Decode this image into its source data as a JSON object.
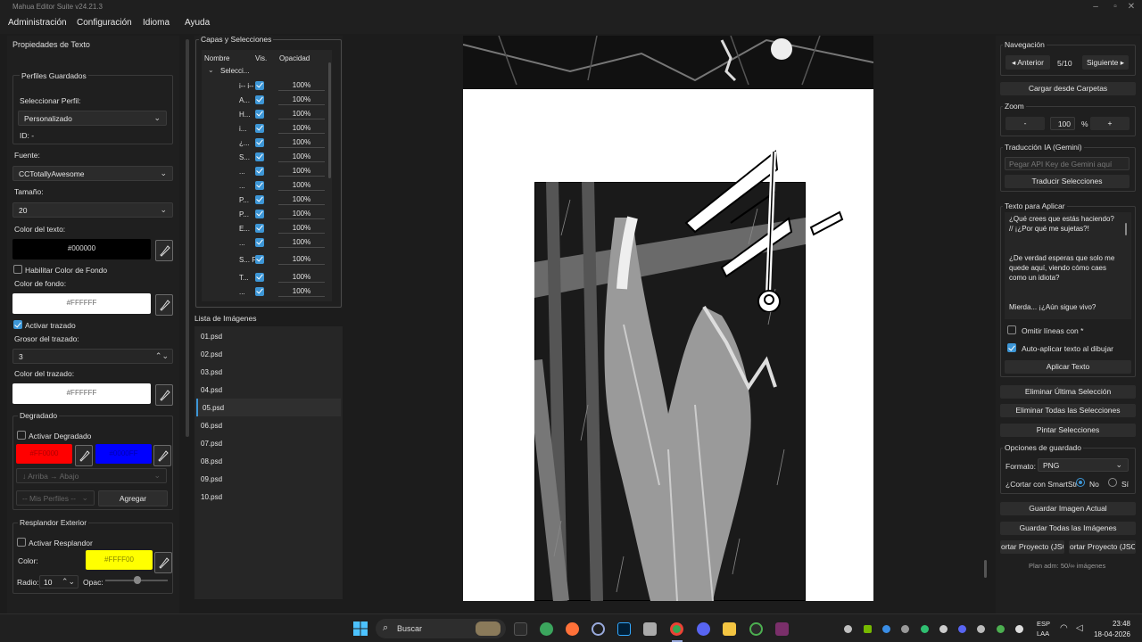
{
  "window": {
    "title": "Mahua Editor Suite v24.21.3"
  },
  "menu": [
    "Administración",
    "Configuración",
    "Idioma",
    "Ayuda"
  ],
  "text_props": {
    "title": "Propiedades de Texto",
    "profiles_group": "Perfiles Guardados",
    "select_profile_label": "Seleccionar Perfil:",
    "profile_value": "Personalizado",
    "id_label": "ID: -",
    "font_label": "Fuente:",
    "font_value": "CCTotallyAwesome",
    "size_label": "Tamaño:",
    "size_value": "20",
    "text_color_label": "Color del texto:",
    "text_color_value": "#000000",
    "enable_bg_label": "Habilitar Color de Fondo",
    "bg_color_label": "Color de fondo:",
    "bg_color_value": "#FFFFFF",
    "stroke_enable_label": "Activar trazado",
    "stroke_width_label": "Grosor del trazado:",
    "stroke_width_value": "3",
    "stroke_color_label": "Color del trazado:",
    "stroke_color_value": "#FFFFFF",
    "gradient_group": "Degradado",
    "gradient_enable_label": "Activar Degradado",
    "gradient_color1": "#FF0000",
    "gradient_color2": "#0000FF",
    "gradient_direction": "↓ Arriba → Abajo",
    "my_profiles": "-- Mis Perfiles --",
    "add_button": "Agregar",
    "glow_group": "Resplandor Exterior",
    "glow_enable_label": "Activar Resplandor",
    "glow_color_label": "Color:",
    "glow_color_value": "#FFFF00",
    "radius_label": "Radio:",
    "radius_value": "10",
    "opacity_label": "Opac:"
  },
  "layers": {
    "title": "Capas y Selecciones",
    "columns": [
      "Nombre",
      "Vis.",
      "Opacidad"
    ],
    "group_name": "Selecci...",
    "rows": [
      {
        "name": "i-- i--",
        "opacity": "100%"
      },
      {
        "name": "A...",
        "opacity": "100%"
      },
      {
        "name": "H...",
        "opacity": "100%"
      },
      {
        "name": "i...",
        "opacity": "100%"
      },
      {
        "name": "¿...",
        "opacity": "100%"
      },
      {
        "name": "S...",
        "opacity": "100%"
      },
      {
        "name": "...",
        "opacity": "100%"
      },
      {
        "name": "...",
        "opacity": "100%"
      },
      {
        "name": "P...",
        "opacity": "100%"
      },
      {
        "name": "P...",
        "opacity": "100%"
      },
      {
        "name": "E...",
        "opacity": "100%"
      },
      {
        "name": "...",
        "opacity": "100%"
      },
      {
        "name": "S... F...",
        "opacity": "100%"
      },
      {
        "name": "T...",
        "opacity": "100%"
      },
      {
        "name": "...",
        "opacity": "100%"
      }
    ]
  },
  "images": {
    "title": "Lista de Imágenes",
    "items": [
      "01.psd",
      "02.psd",
      "03.psd",
      "04.psd",
      "05.psd",
      "06.psd",
      "07.psd",
      "08.psd",
      "09.psd",
      "10.psd"
    ],
    "selected_index": 4
  },
  "nav": {
    "title": "Navegación",
    "prev": "◂ Anterior",
    "counter": "5/10",
    "next": "Siguiente ▸",
    "load_folder": "Cargar desde Carpetas"
  },
  "zoom": {
    "title": "Zoom",
    "minus": "-",
    "value": "100",
    "unit": "%",
    "plus": "+"
  },
  "ai": {
    "title": "Traducción IA (Gemini)",
    "placeholder": "Pegar API Key de Gemini aquí",
    "translate_button": "Traducir Selecciones"
  },
  "apply_text": {
    "title": "Texto para Aplicar",
    "lines": [
      "¿Qué crees que estás haciendo?",
      "// ¡¿Por qué me sujetas?!",
      "",
      "",
      "¿De verdad esperas que solo me",
      "quede aquí, viendo cómo caes",
      "como un idiota?",
      "",
      "",
      "Mierda... ¡¿Aún sigue vivo?"
    ],
    "omit_label": "Omitir líneas con *",
    "auto_apply_label": "Auto-aplicar texto al dibujar",
    "apply_button": "Aplicar Texto"
  },
  "actions": {
    "delete_last": "Eliminar Última Selección",
    "delete_all": "Eliminar Todas las Selecciones",
    "paint": "Pintar Selecciones"
  },
  "save": {
    "title": "Opciones de guardado",
    "format_label": "Formato:",
    "format_value": "PNG",
    "smartcrop_label": "¿Cortar con SmartStr",
    "no_label": "No",
    "si_label": "Sí",
    "save_current": "Guardar Imagen Actual",
    "save_all": "Guardar Todas las Imágenes",
    "export1": "ortar Proyecto (JSC",
    "export2": "ortar Proyecto (JSC",
    "plan": "Plan adm: 50/∞ imágenes"
  },
  "taskbar": {
    "search": "Buscar",
    "lang1": "ESP",
    "lang2": "LAA",
    "time": "23:48",
    "date": "18-04-2026"
  }
}
